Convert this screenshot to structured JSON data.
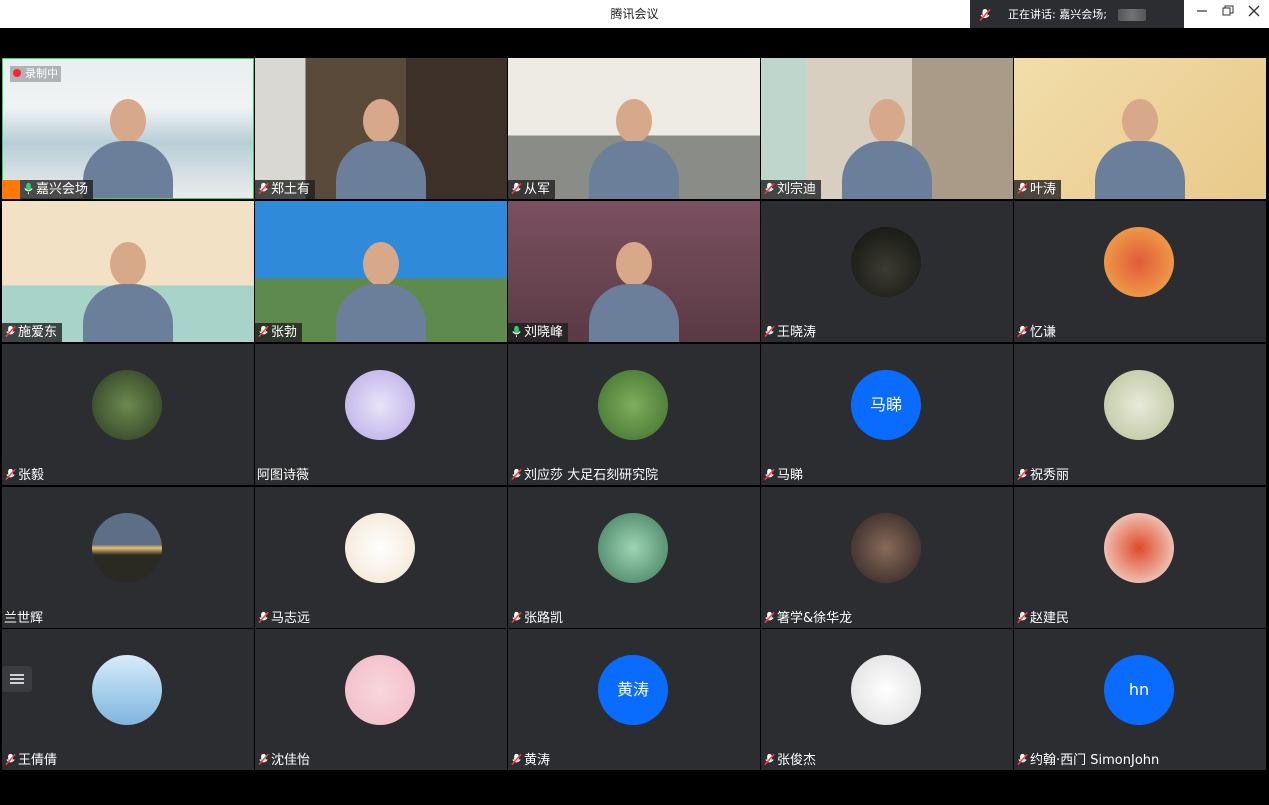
{
  "window": {
    "title": "腾讯会议"
  },
  "speaking_indicator": {
    "text": "正在讲话: 嘉兴会场;"
  },
  "window_controls": [
    "minimize",
    "restore",
    "close"
  ],
  "recording": {
    "label": "录制中"
  },
  "tiles": [
    {
      "name": "嘉兴会场",
      "type": "video",
      "host": true,
      "active": true,
      "mic": "on",
      "scene": "conference_room"
    },
    {
      "name": "郑土有",
      "type": "video",
      "mic": "muted",
      "scene": "bookshelf"
    },
    {
      "name": "从军",
      "type": "video",
      "mic": "muted",
      "scene": "living_room"
    },
    {
      "name": "刘宗迪",
      "type": "video",
      "mic": "muted",
      "scene": "bookshelf_window"
    },
    {
      "name": "叶涛",
      "type": "video",
      "mic": "muted",
      "scene": "gold_background"
    },
    {
      "name": "施爱东",
      "type": "video",
      "mic": "muted",
      "scene": "banner"
    },
    {
      "name": "张勃",
      "type": "video",
      "mic": "muted",
      "scene": "mountains"
    },
    {
      "name": "刘晓峰",
      "type": "video",
      "mic": "on",
      "scene": "carving"
    },
    {
      "name": "王晓涛",
      "type": "avatar",
      "mic": "muted",
      "avatar": "photo-dark"
    },
    {
      "name": "忆谦",
      "type": "avatar",
      "mic": "muted",
      "avatar": "photo-orange"
    },
    {
      "name": "张毅",
      "type": "avatar",
      "mic": "muted",
      "avatar": "photo-green"
    },
    {
      "name": "阿图诗薇",
      "type": "avatar",
      "mic": "none",
      "avatar": "cartoon-purple"
    },
    {
      "name": "刘应莎 大足石刻研究院",
      "type": "avatar",
      "mic": "muted",
      "avatar": "leaves"
    },
    {
      "name": "马睇",
      "type": "avatar",
      "mic": "muted",
      "avatar_text": "马睇"
    },
    {
      "name": "祝秀丽",
      "type": "avatar",
      "mic": "muted",
      "avatar": "field"
    },
    {
      "name": "兰世辉",
      "type": "avatar",
      "mic": "none",
      "avatar": "sunset"
    },
    {
      "name": "马志远",
      "type": "avatar",
      "mic": "muted",
      "avatar": "cartoon-cat"
    },
    {
      "name": "张路凯",
      "type": "avatar",
      "mic": "muted",
      "avatar": "rabbit-green"
    },
    {
      "name": "箸学&徐华龙",
      "type": "avatar",
      "mic": "muted",
      "avatar": "photo-man"
    },
    {
      "name": "赵建民",
      "type": "avatar",
      "mic": "muted",
      "avatar": "tiger-red"
    },
    {
      "name": "王倩倩",
      "type": "avatar",
      "mic": "muted",
      "avatar": "sky-clouds"
    },
    {
      "name": "沈佳怡",
      "type": "avatar",
      "mic": "muted",
      "avatar": "pink-cat"
    },
    {
      "name": "黄涛",
      "type": "avatar",
      "mic": "muted",
      "avatar_text": "黄涛"
    },
    {
      "name": "张俊杰",
      "type": "avatar",
      "mic": "muted",
      "avatar": "manga-sketch"
    },
    {
      "name": "约翰·西门 SimonJohn",
      "type": "avatar",
      "mic": "muted",
      "avatar_text": "hn"
    }
  ],
  "colors": {
    "tile_bg": "#2b2d31",
    "avatar_blue": "#0a6cff",
    "active_border": "#33d35a",
    "host_orange": "#ff7a00"
  }
}
